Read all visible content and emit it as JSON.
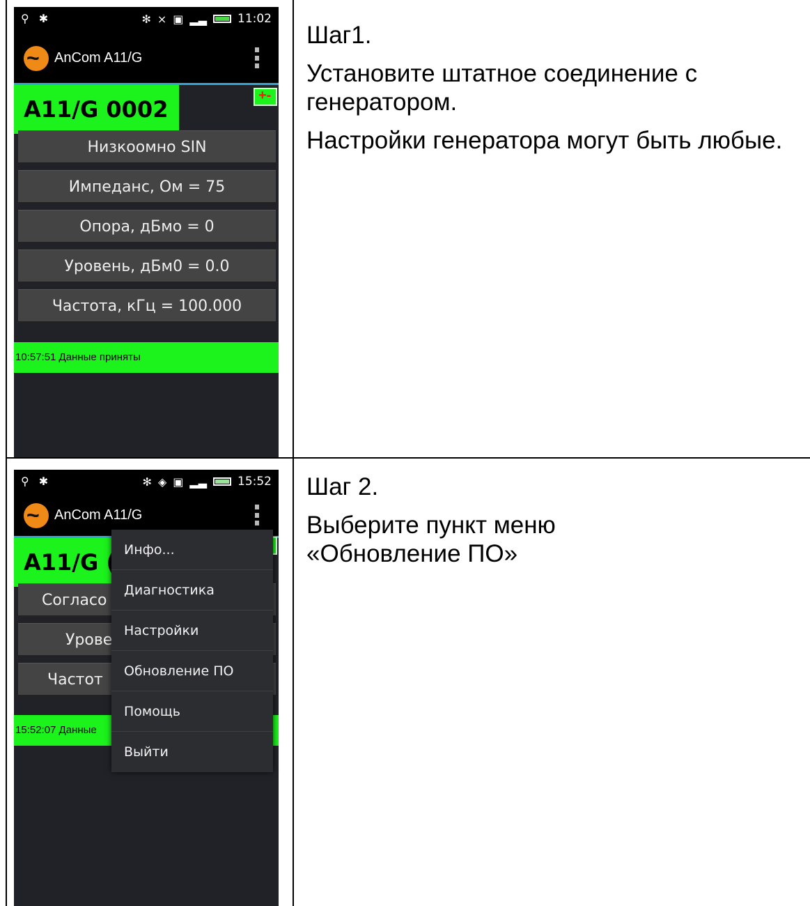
{
  "step1": {
    "phone": {
      "status_time": "11:02",
      "app_title": "AnCom A11/G",
      "device_label": "A11/G 0002",
      "params": [
        "Низкоомно SIN",
        "Импеданс, Ом = 75",
        "Опора, дБмо = 0",
        "Уровень, дБм0 = 0.0",
        "Частота, кГц = 100.000"
      ],
      "status_text": "10:57:51 Данные приняты"
    },
    "heading": "Шаг1.",
    "paragraphs": [
      "Установите штатное соединение с генератором.",
      "Настройки генератора могут быть любые."
    ]
  },
  "step2": {
    "phone": {
      "status_time": "15:52",
      "app_title": "AnCom A11/G",
      "device_label": "A11/G (",
      "params": [
        "Согласо",
        "Урове",
        "Частот"
      ],
      "status_text": "15:52:07 Данные",
      "menu": [
        "Инфо...",
        "Диагностика",
        "Настройки",
        "Обновление ПО",
        "Помощь",
        "Выйти"
      ]
    },
    "heading": "Шаг 2.",
    "paragraphs": [
      "Выберите пункт меню «Обновление ПО»"
    ]
  },
  "colors": {
    "accent_green": "#1cf21c",
    "app_logo": "#f08a16",
    "actionbar_line": "#33a6d6"
  }
}
